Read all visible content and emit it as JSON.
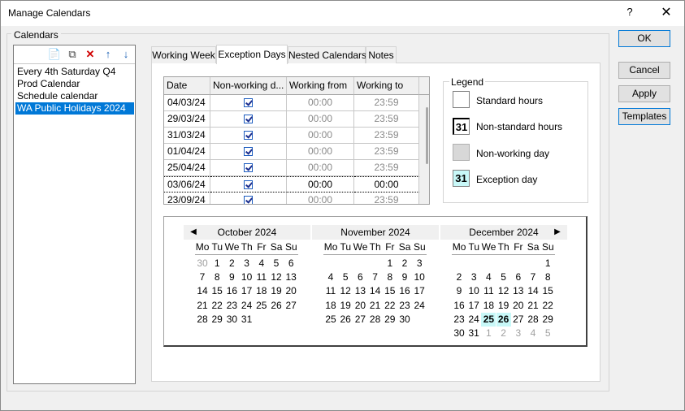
{
  "window": {
    "title": "Manage Calendars",
    "help": "?",
    "close": "✕"
  },
  "group_label": "Calendars",
  "list_toolbar": {
    "new": "📄",
    "copy": "⧉",
    "delete": "✕",
    "up": "↑",
    "down": "↓"
  },
  "calendars": [
    "Every 4th Saturday Q4",
    "Prod Calendar",
    "Schedule calendar",
    "WA Public Holidays 2024"
  ],
  "tabs": [
    "Working Week",
    "Exception Days",
    "Nested Calendars",
    "Notes"
  ],
  "grid": {
    "headers": [
      "Date",
      "Non-working d...",
      "Working from",
      "Working to"
    ],
    "rows": [
      {
        "date": "04/03/24",
        "from": "00:00",
        "to": "23:59"
      },
      {
        "date": "29/03/24",
        "from": "00:00",
        "to": "23:59"
      },
      {
        "date": "31/03/24",
        "from": "00:00",
        "to": "23:59"
      },
      {
        "date": "01/04/24",
        "from": "00:00",
        "to": "23:59"
      },
      {
        "date": "25/04/24",
        "from": "00:00",
        "to": "23:59"
      },
      {
        "date": "03/06/24",
        "from": "00:00",
        "to": "00:00"
      },
      {
        "date": "23/09/24",
        "from": "00:00",
        "to": "23:59"
      }
    ]
  },
  "legend": {
    "title": "Legend",
    "items": [
      {
        "label": "Standard hours",
        "glyph": ""
      },
      {
        "label": "Non-standard hours",
        "glyph": "31"
      },
      {
        "label": "Non-working day",
        "glyph": ""
      },
      {
        "label": "Exception day",
        "glyph": "31"
      }
    ]
  },
  "calendar": {
    "prev": "◀",
    "next": "▶",
    "dow": [
      "Mo",
      "Tu",
      "We",
      "Th",
      "Fr",
      "Sa",
      "Su"
    ],
    "months": [
      {
        "title": "October 2024",
        "weeks": [
          [
            "30",
            "1",
            "2",
            "3",
            "4",
            "5",
            "6"
          ],
          [
            "7",
            "8",
            "9",
            "10",
            "11",
            "12",
            "13"
          ],
          [
            "14",
            "15",
            "16",
            "17",
            "18",
            "19",
            "20"
          ],
          [
            "21",
            "22",
            "23",
            "24",
            "25",
            "26",
            "27"
          ],
          [
            "28",
            "29",
            "30",
            "31",
            "",
            "",
            ""
          ]
        ],
        "gray": [
          "0-0"
        ]
      },
      {
        "title": "November 2024",
        "weeks": [
          [
            "",
            "",
            "",
            "",
            "1",
            "2",
            "3"
          ],
          [
            "4",
            "5",
            "6",
            "7",
            "8",
            "9",
            "10"
          ],
          [
            "11",
            "12",
            "13",
            "14",
            "15",
            "16",
            "17"
          ],
          [
            "18",
            "19",
            "20",
            "21",
            "22",
            "23",
            "24"
          ],
          [
            "25",
            "26",
            "27",
            "28",
            "29",
            "30",
            ""
          ]
        ],
        "gray": []
      },
      {
        "title": "December 2024",
        "weeks": [
          [
            "",
            "",
            "",
            "",
            "",
            "",
            "1"
          ],
          [
            "2",
            "3",
            "4",
            "5",
            "6",
            "7",
            "8"
          ],
          [
            "9",
            "10",
            "11",
            "12",
            "13",
            "14",
            "15"
          ],
          [
            "16",
            "17",
            "18",
            "19",
            "20",
            "21",
            "22"
          ],
          [
            "23",
            "24",
            "25",
            "26",
            "27",
            "28",
            "29"
          ],
          [
            "30",
            "31",
            "1",
            "2",
            "3",
            "4",
            "5"
          ]
        ],
        "gray": [
          "5-2",
          "5-3",
          "5-4",
          "5-5",
          "5-6"
        ],
        "exception": [
          "4-2",
          "4-3"
        ]
      }
    ]
  },
  "buttons": {
    "ok": "OK",
    "cancel": "Cancel",
    "apply": "Apply",
    "templates": "Templates"
  }
}
